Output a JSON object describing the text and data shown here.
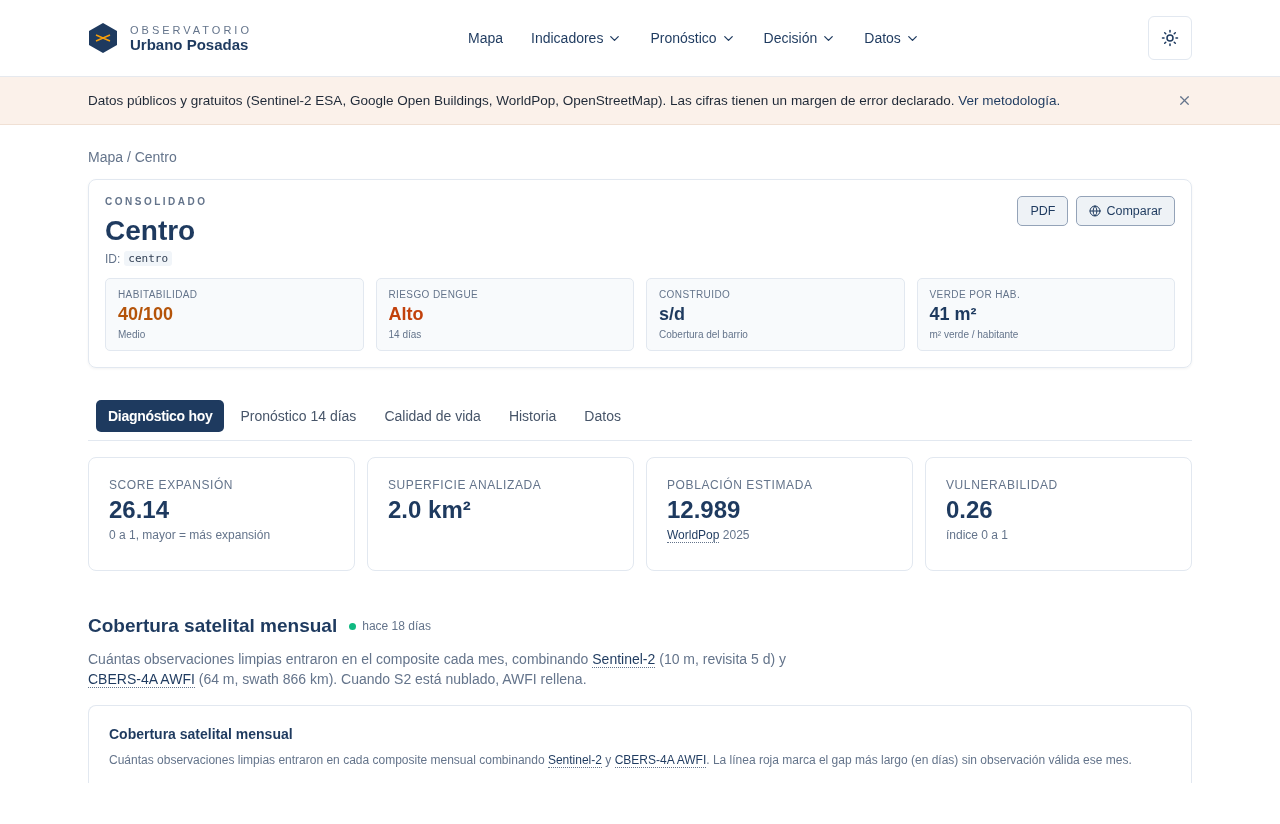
{
  "brand": {
    "eyebrow": "OBSERVATORIO",
    "name": "Urbano Posadas"
  },
  "nav": [
    {
      "label": "Mapa",
      "dropdown": false
    },
    {
      "label": "Indicadores",
      "dropdown": true
    },
    {
      "label": "Pronóstico",
      "dropdown": true
    },
    {
      "label": "Decisión",
      "dropdown": true
    },
    {
      "label": "Datos",
      "dropdown": true
    }
  ],
  "banner": {
    "text": "Datos públicos y gratuitos (Sentinel-2 ESA, Google Open Buildings, WorldPop, OpenStreetMap). Las cifras tienen un margen de error declarado.",
    "link": "Ver metodología."
  },
  "breadcrumb": "Mapa / Centro",
  "zone": {
    "eyebrow": "CONSOLIDADO",
    "title": "Centro",
    "id_label": "ID:",
    "id": "centro",
    "buttons": [
      {
        "label": "PDF",
        "icon": false
      },
      {
        "label": "Comparar",
        "icon": true
      }
    ],
    "stats": [
      {
        "label": "HABITABILIDAD",
        "value": "40/100",
        "note": "Medio",
        "color": "#b45309"
      },
      {
        "label": "RIESGO DENGUE",
        "value": "Alto",
        "note": "14 días",
        "color": "#c2410c"
      },
      {
        "label": "CONSTRUIDO",
        "value": "s/d",
        "note": "Cobertura del barrio",
        "color": "#1e3a5f"
      },
      {
        "label": "VERDE POR HAB.",
        "value": "41 m²",
        "note": "m² verde / habitante",
        "color": "#1e3a5f"
      }
    ]
  },
  "tabs": [
    {
      "label": "Diagnóstico hoy",
      "selected": true
    },
    {
      "label": "Pronóstico 14 días",
      "selected": false
    },
    {
      "label": "Calidad de vida",
      "selected": false
    },
    {
      "label": "Historia",
      "selected": false
    },
    {
      "label": "Datos",
      "selected": false
    }
  ],
  "metrics": [
    {
      "label": "SCORE EXPANSIÓN",
      "value": "26.14",
      "note": [
        {
          "kind": "text",
          "text": "0 a 1, mayor = más expansión"
        }
      ]
    },
    {
      "label": "SUPERFICIE ANALIZADA",
      "value": "2.0 km²"
    },
    {
      "label": "POBLACIÓN ESTIMADA",
      "value": "12.989",
      "note": [
        {
          "kind": "link",
          "text": "WorldPop"
        },
        {
          "kind": "text",
          "text": " 2025"
        }
      ]
    },
    {
      "label": "VULNERABILIDAD",
      "value": "0.26",
      "note": [
        {
          "kind": "text",
          "text": "índice 0 a 1"
        }
      ]
    }
  ],
  "section": {
    "title": "Cobertura satelital mensual",
    "freshness": "hace 18 días",
    "description": [
      {
        "kind": "text",
        "text": "Cuántas observaciones limpias entraron en el composite cada mes, combinando "
      },
      {
        "kind": "link",
        "text": "Sentinel-2"
      },
      {
        "kind": "text",
        "text": " (10 m, revisita 5 d) y "
      },
      {
        "kind": "break"
      },
      {
        "kind": "link",
        "text": "CBERS-4A AWFI"
      },
      {
        "kind": "text",
        "text": " (64 m, swath 866 km). Cuando S2 está nublado, AWFI rellena."
      }
    ],
    "card": {
      "title": "Cobertura satelital mensual",
      "description": [
        {
          "kind": "text",
          "text": "Cuántas observaciones limpias entraron en cada composite mensual combinando "
        },
        {
          "kind": "link",
          "text": "Sentinel-2"
        },
        {
          "kind": "text",
          "text": " y "
        },
        {
          "kind": "link",
          "text": "CBERS-4A AWFI"
        },
        {
          "kind": "text",
          "text": ". La línea roja marca el gap más largo (en días) sin observación válida ese mes."
        }
      ]
    }
  }
}
